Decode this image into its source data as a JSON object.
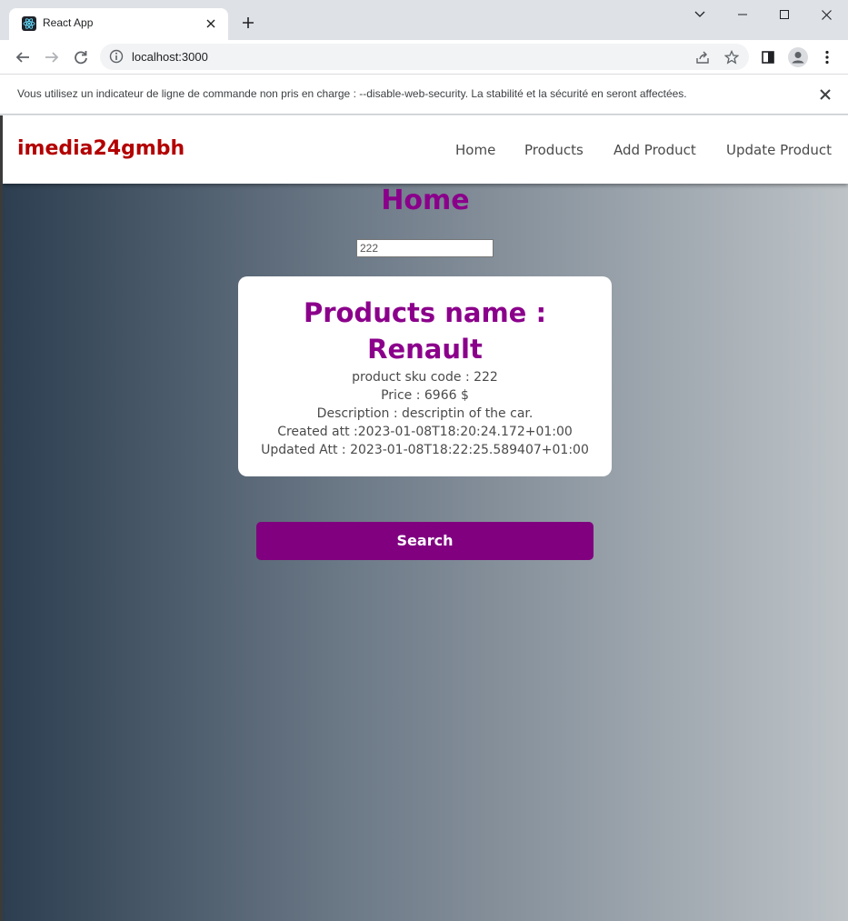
{
  "browser": {
    "tab_title": "React App",
    "url": "localhost:3000",
    "infobar_message": "Vous utilisez un indicateur de ligne de commande non pris en charge : --disable-web-security. La stabilité et la sécurité en seront affectées."
  },
  "page": {
    "brand": "imedia24gmbh",
    "nav": [
      {
        "label": "Home"
      },
      {
        "label": "Products"
      },
      {
        "label": "Add Product"
      },
      {
        "label": "Update Product"
      }
    ],
    "title": "Home",
    "search": {
      "value": "222",
      "button_label": "Search"
    },
    "product_card": {
      "name_line1": "Products name :",
      "name_line2": "Renault",
      "sku": "product sku code : 222",
      "price": "Price : 6966 $",
      "description": "Description : descriptin of the car.",
      "created": "Created att :2023-01-08T18:20:24.172+01:00",
      "updated": "Updated Att : 2023-01-08T18:22:25.589407+01:00"
    }
  },
  "colors": {
    "brand": "#b30000",
    "accent": "#8b008b",
    "button": "#800080"
  }
}
